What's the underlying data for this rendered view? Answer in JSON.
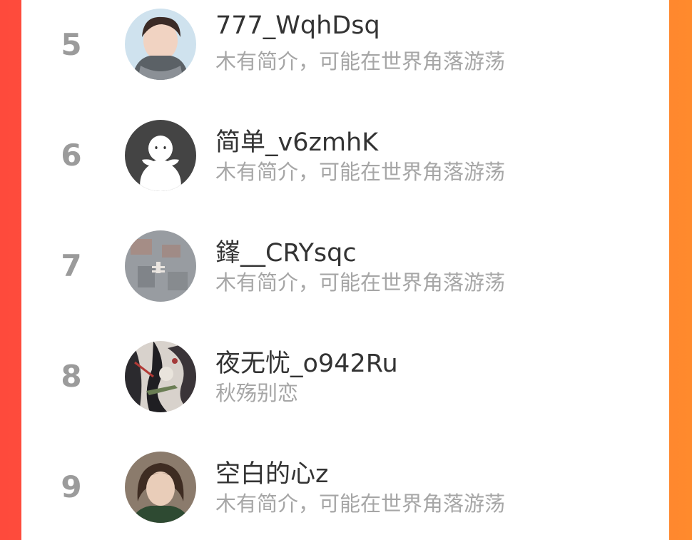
{
  "colors": {
    "background_left": "#fe4a3c",
    "background_right": "#ff8a2d",
    "card": "#ffffff",
    "rank_text": "#9b9b9b",
    "name_text": "#333333",
    "bio_text": "#a6a6a6"
  },
  "ranking": {
    "items": [
      {
        "rank": "5",
        "name": "777_WqhDsq",
        "bio": "木有简介，可能在世界角落游荡",
        "avatar": "user-photo-avatar"
      },
      {
        "rank": "6",
        "name": "简单_v6zmhK",
        "bio": "木有简介，可能在世界角落游荡",
        "avatar": "default-avatar"
      },
      {
        "rank": "7",
        "name": "鎽__CRYsqc",
        "bio": "木有简介，可能在世界角落游荡",
        "avatar": "aerial-photo-avatar"
      },
      {
        "rank": "8",
        "name": "夜无忧_o942Ru",
        "bio": "秋殇别恋",
        "avatar": "anime-art-avatar"
      },
      {
        "rank": "9",
        "name": "空白的心z",
        "bio": "木有简介，可能在世界角落游荡",
        "avatar": "portrait-photo-avatar"
      }
    ]
  }
}
